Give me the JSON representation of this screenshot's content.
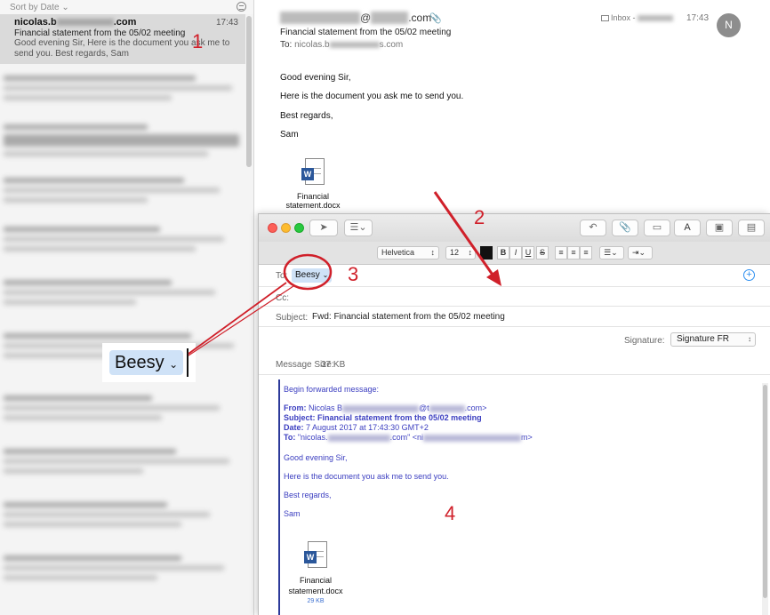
{
  "list": {
    "sort_label": "Sort by Date ⌄",
    "selected": {
      "sender": "nicolas.b",
      "sender_tail": ".com",
      "time": "17:43",
      "subject": "Financial statement from the 05/02 meeting",
      "preview": "Good evening Sir, Here is the document you ask me to send you. Best regards, Sam"
    }
  },
  "message": {
    "from_tail": "@",
    "from_domain": ".com",
    "mailbox": "Inbox -",
    "time": "17:43",
    "avatar_initial": "N",
    "subject": "Financial statement from the 05/02 meeting",
    "to_label": "To:",
    "to_value": "nicolas.b",
    "to_value_tail": "s.com",
    "body": [
      "Good evening Sir,",
      "Here is the document you ask me to send you.",
      "Best regards,",
      "Sam"
    ],
    "attachment_name": "Financial statement.docx"
  },
  "compose": {
    "format": {
      "font": "Helvetica",
      "size": "12",
      "bold": "B",
      "italic": "I",
      "underline": "U",
      "strike": "S"
    },
    "to_label": "To:",
    "to_chip": "Beesy",
    "cc_label": "Cc:",
    "subject_label": "Subject:",
    "subject_value": "Fwd: Financial statement from the 05/02 meeting",
    "signature_label": "Signature:",
    "signature_value": "Signature FR",
    "size_label": "Message Size:",
    "size_value": "37 KB",
    "forwarded": {
      "intro": "Begin forwarded message:",
      "from_label": "From:",
      "from_value": "Nicolas B",
      "from_value_tail": "@t",
      "from_value_end": ".com>",
      "subject_label": "Subject:",
      "subject_value": "Financial statement from the 05/02 meeting",
      "date_label": "Date:",
      "date_value": "7 August 2017 at 17:43:30 GMT+2",
      "to_label": "To:",
      "to_value": "\"nicolas.",
      "to_value_mid": ".com\" <ni",
      "to_value_end": "m>",
      "body": [
        "Good evening Sir,",
        "Here is the document you ask me to send you.",
        "Best regards,",
        "Sam"
      ],
      "attachment_name": "Financial statement.docx",
      "attachment_size": "29 KB"
    }
  },
  "annotations": {
    "one": "1",
    "two": "2",
    "three": "3",
    "four": "4",
    "zoom_chip": "Beesy"
  },
  "colors": {
    "accent": "#d0202a",
    "link_blue": "#3b3ec0",
    "chip_blue": "#cfe2f7"
  },
  "icons": {
    "toolbar": [
      "send-icon",
      "list-icon",
      "reply-icon",
      "paperclip-icon",
      "markup-icon",
      "font-icon",
      "photo-icon",
      "sidebar-icon"
    ]
  }
}
